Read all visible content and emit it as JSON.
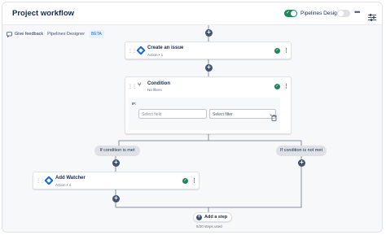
{
  "header": {
    "title": "Project workflow",
    "designer_label": "Pipelines Designer"
  },
  "subheader": {
    "feedback_label": "Give feedback",
    "product_label": "Pipelines Designer",
    "badge": "BETA"
  },
  "steps": [
    {
      "title": "Create an issue",
      "subtitle": "Action • 1"
    },
    {
      "title": "Condition",
      "subtitle": "No filters",
      "if_label": "IF:",
      "field_placeholder": "Select field",
      "filter_placeholder": "Select filter"
    },
    {
      "title": "Add Watcher",
      "subtitle": "Action • 4"
    }
  ],
  "branches": {
    "met": "If condition is met",
    "not_met": "If condition is not met"
  },
  "footer": {
    "add_step_label": "Add a step",
    "steps_used": "6/20 steps used"
  },
  "colors": {
    "accent": "#1868db",
    "success": "#1f845a",
    "node": "#44546f"
  }
}
